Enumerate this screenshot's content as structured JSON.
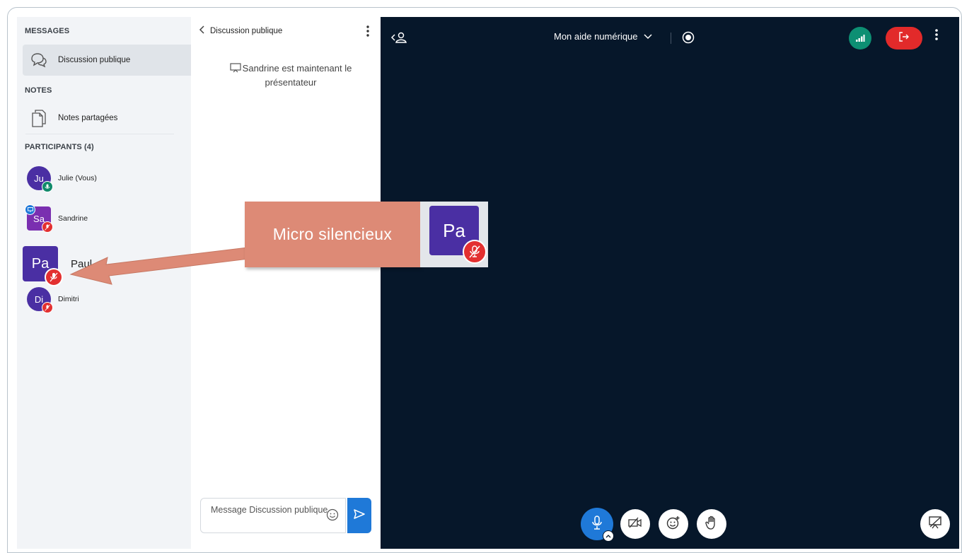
{
  "sidebar": {
    "messages_title": "MESSAGES",
    "public_chat_label": "Discussion publique",
    "notes_title": "NOTES",
    "shared_notes_label": "Notes partagées",
    "participants_title": "PARTICIPANTS (4)",
    "participants": [
      {
        "initials": "Ju",
        "name": "Julie (Vous)",
        "mic": "on"
      },
      {
        "initials": "Sa",
        "name": "Sandrine",
        "mic": "muted",
        "presenter": true
      },
      {
        "initials": "Pa",
        "name": "Paul",
        "mic": "muted"
      },
      {
        "initials": "Di",
        "name": "Dimitri",
        "mic": "muted"
      }
    ]
  },
  "chat": {
    "title": "Discussion publique",
    "system_message": "Sandrine est maintenant le présentateur",
    "input_placeholder": "Message Discussion publique"
  },
  "video": {
    "meeting_title": "Mon aide numérique"
  },
  "annotation": {
    "callout_text": "Micro silencieux",
    "callout_avatar_initials": "Pa"
  },
  "colors": {
    "accent_blue": "#1f79d8",
    "muted_red": "#e33030",
    "leave_red": "#e22a2a",
    "video_bg": "#06172a",
    "avatar_purple": "#4a2fa3",
    "callout_orange": "#dd8a76",
    "connection_green": "#0d8f73"
  }
}
